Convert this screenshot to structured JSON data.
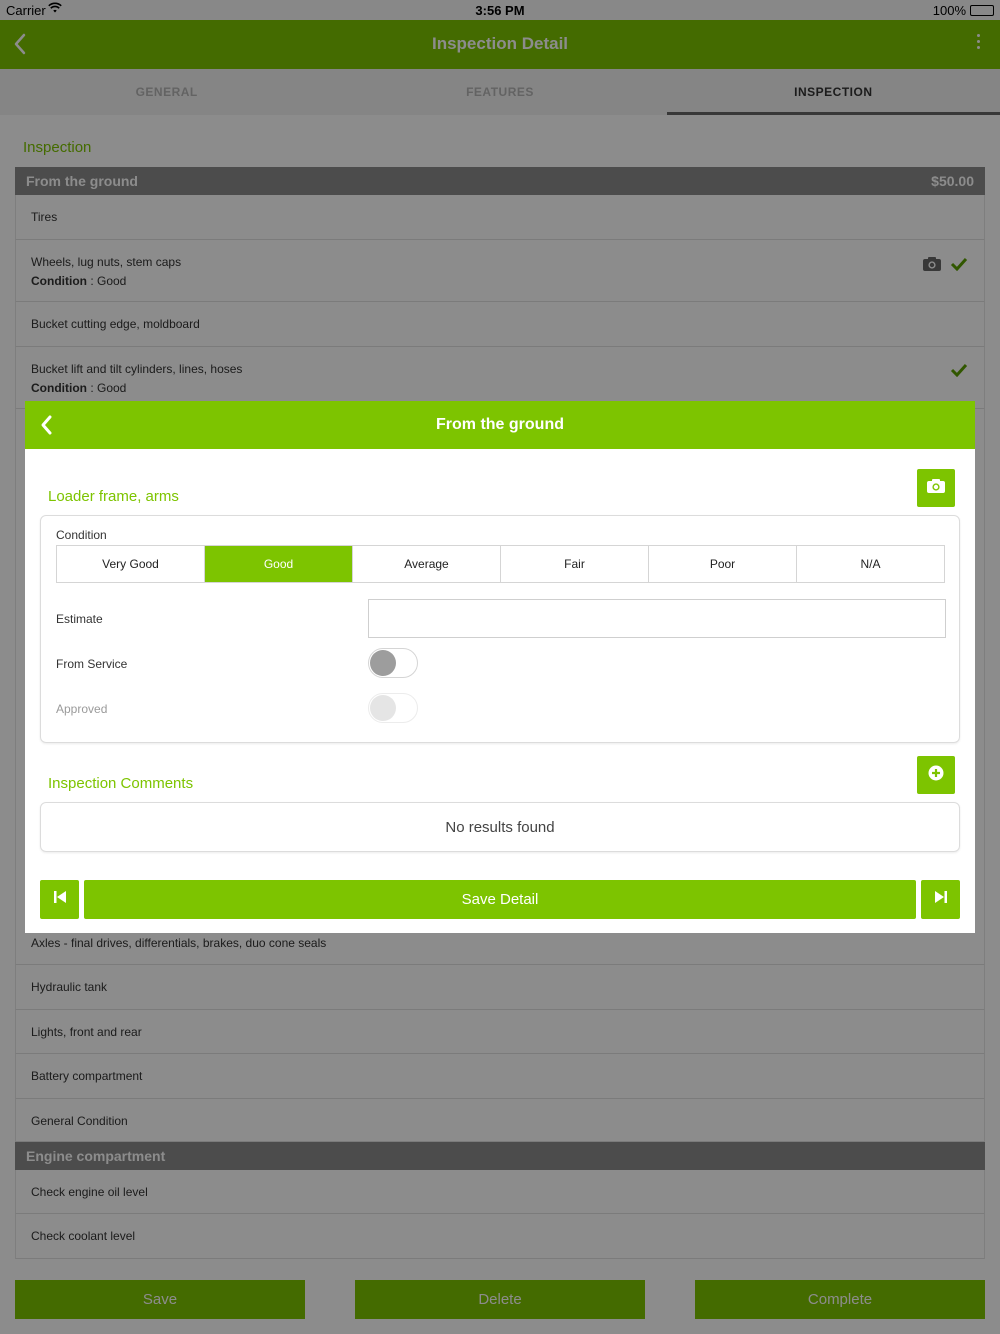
{
  "status_bar": {
    "carrier": "Carrier",
    "time": "3:56 PM",
    "battery": "100%"
  },
  "app_bar": {
    "title": "Inspection Detail"
  },
  "tabs": [
    {
      "label": "GENERAL",
      "active": false
    },
    {
      "label": "FEATURES",
      "active": false
    },
    {
      "label": "INSPECTION",
      "active": true
    }
  ],
  "section_title": "Inspection",
  "groups": [
    {
      "title": "From the ground",
      "price": "$50.00"
    },
    {
      "title": "Engine compartment",
      "price": ""
    }
  ],
  "rows": [
    {
      "name": "Tires"
    },
    {
      "name": "Wheels, lug nuts, stem caps",
      "condition_label": "Condition",
      "condition": "Good",
      "has_photo": true,
      "checked": true
    },
    {
      "name": "Bucket cutting edge, moldboard"
    },
    {
      "name": "Bucket lift and tilt cylinders, lines, hoses",
      "condition_label": "Condition",
      "condition": "Good",
      "checked": true
    },
    {
      "name": "Axles - final drives, differentials, brakes, duo cone seals"
    },
    {
      "name": "Hydraulic tank"
    },
    {
      "name": "Lights, front and rear"
    },
    {
      "name": "Battery compartment"
    },
    {
      "name": "General Condition"
    },
    {
      "name": "Check engine oil level"
    },
    {
      "name": "Check coolant level"
    }
  ],
  "bottom_buttons": {
    "save": "Save",
    "delete": "Delete",
    "complete": "Complete"
  },
  "modal": {
    "title": "From the ground",
    "item_title": "Loader frame, arms",
    "condition_label": "Condition",
    "condition_options": [
      "Very Good",
      "Good",
      "Average",
      "Fair",
      "Poor",
      "N/A"
    ],
    "selected_condition": "Good",
    "estimate_label": "Estimate",
    "estimate_value": "",
    "from_service_label": "From Service",
    "from_service_on": false,
    "approved_label": "Approved",
    "approved_on": false,
    "comments_title": "Inspection Comments",
    "empty_text": "No results found",
    "save_detail": "Save Detail"
  },
  "colors": {
    "accent": "#7dc400",
    "group_header": "#8a8a8a",
    "check": "#5a9e00"
  },
  "icons": [
    "back-arrow-icon",
    "more-vert-icon",
    "camera-icon",
    "checkmark-icon",
    "plus-circle-icon",
    "skip-previous-icon",
    "skip-next-icon"
  ]
}
